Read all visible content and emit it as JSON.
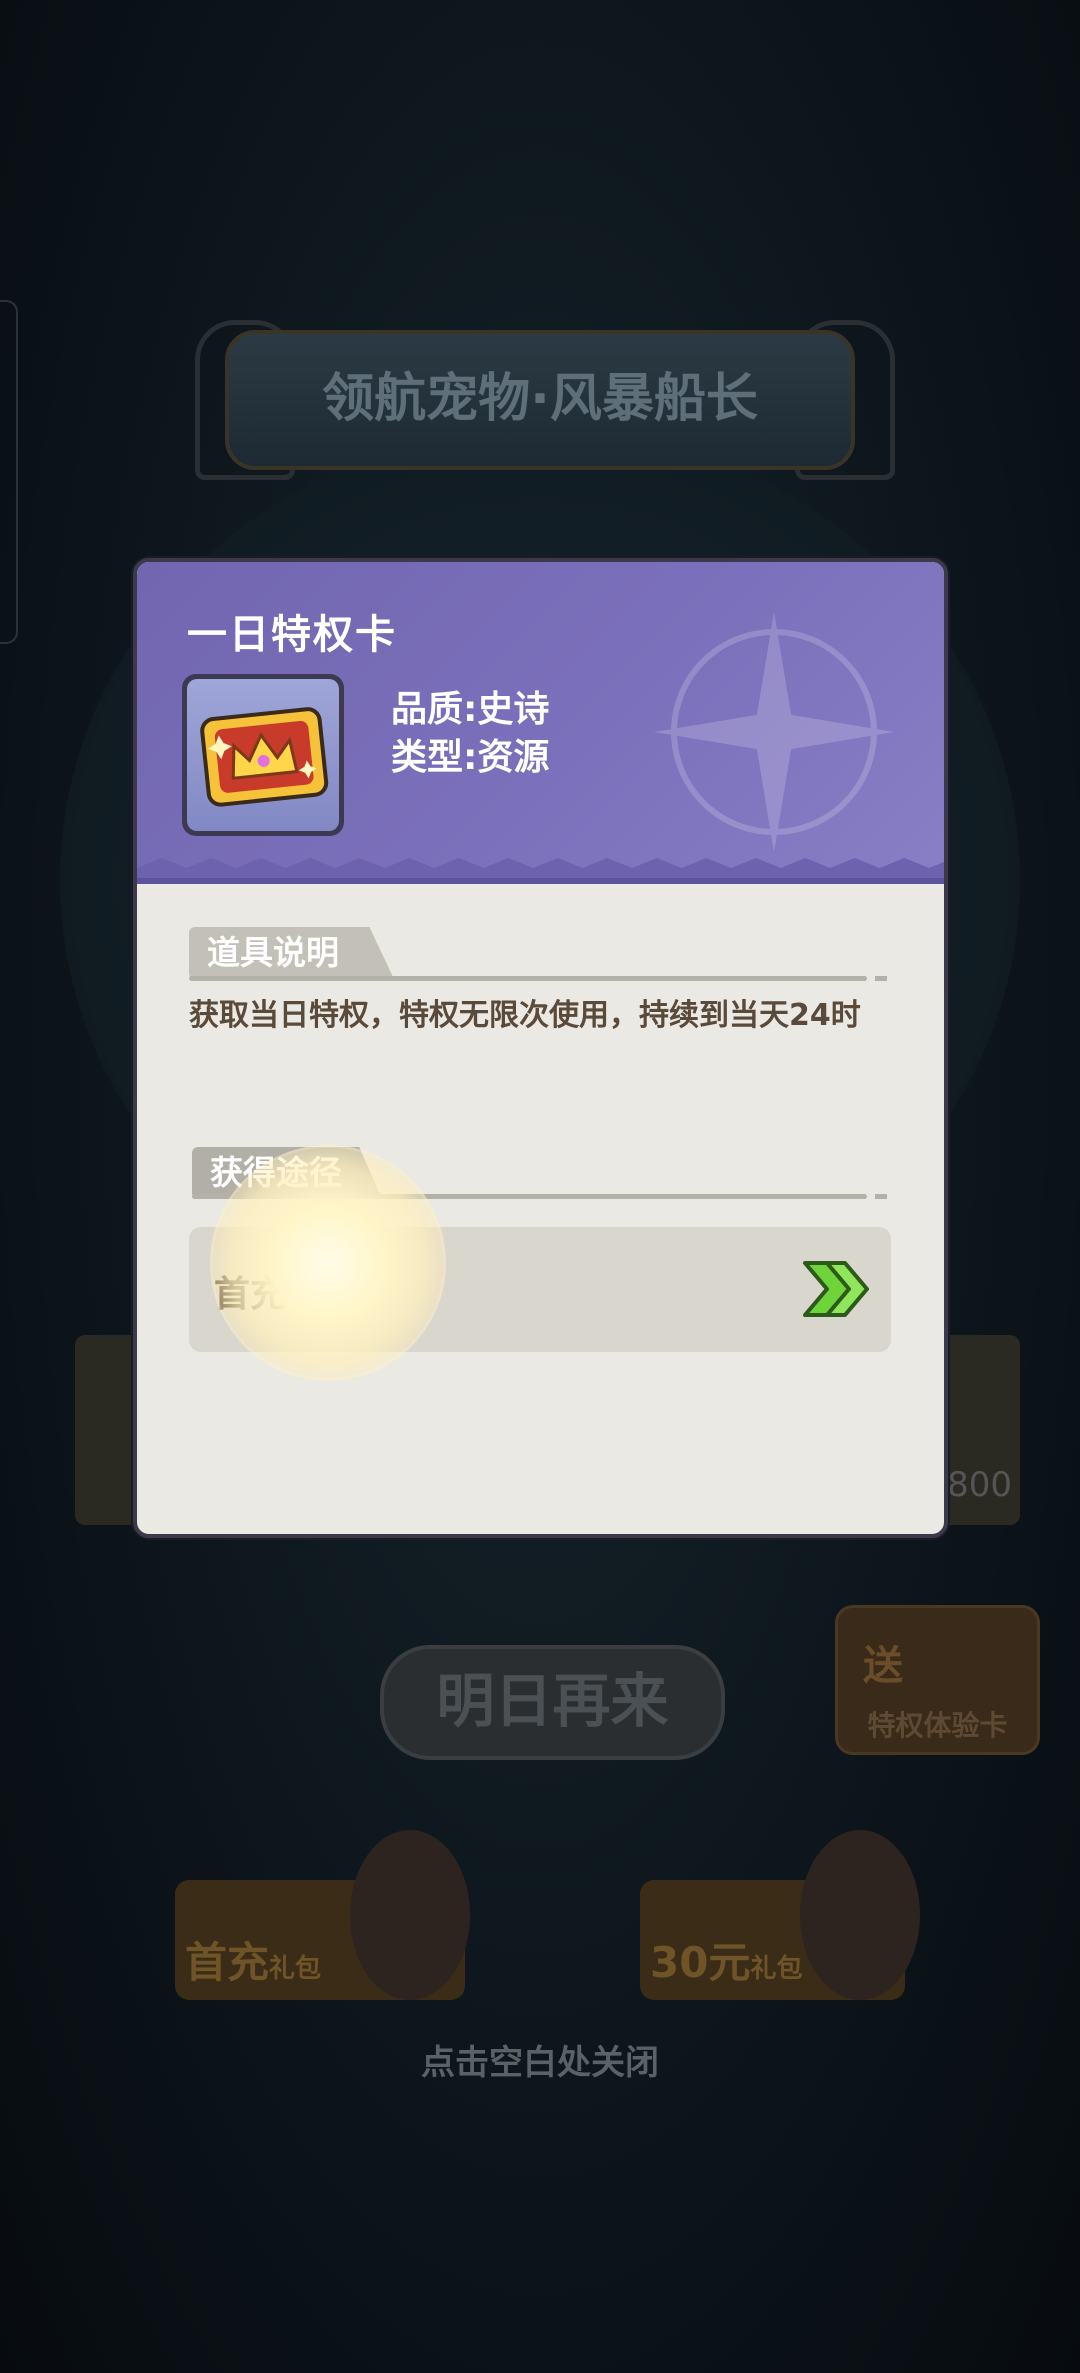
{
  "background": {
    "banner_title": "领航宠物·风暴船长",
    "primary_button": "明日再来",
    "trial_card": {
      "badge": "送",
      "label": "特权体验卡"
    },
    "packs": [
      {
        "title": "首充",
        "suffix": "礼包"
      },
      {
        "title": "30元",
        "suffix": "礼包"
      }
    ],
    "right_slot_value": "800",
    "close_hint": "点击空白处关闭"
  },
  "modal": {
    "item_name": "一日特权卡",
    "item_icon": "crown-ticket-icon",
    "quality": "品质:史诗",
    "type": "类型:资源",
    "description_heading": "道具说明",
    "description": "获取当日特权，特权无限次使用，持续到当天24时",
    "acquire_heading": "获得途径",
    "acquire_sources": [
      {
        "label": "首充",
        "action_icon": "double-chevron-right-icon"
      }
    ]
  },
  "colors": {
    "header_purple": "#7468b3",
    "panel_bg": "#ebe9e4",
    "go_arrow": "#6fd43a"
  }
}
